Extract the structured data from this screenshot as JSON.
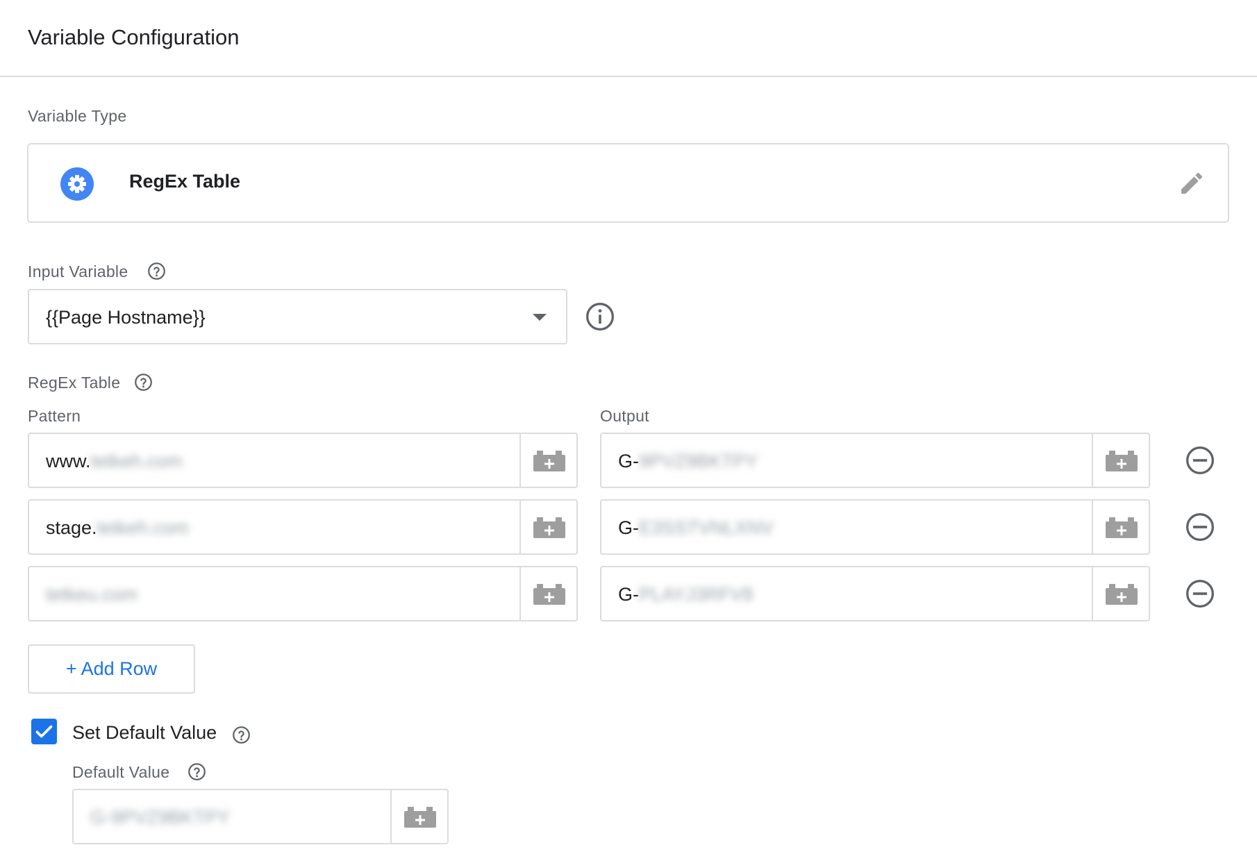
{
  "header": {
    "title": "Variable Configuration"
  },
  "variable_type": {
    "label": "Variable Type",
    "name": "RegEx Table",
    "icon": "gear-icon",
    "edit_icon": "pencil-icon"
  },
  "input_variable": {
    "label": "Input Variable",
    "value": "{{Page Hostname}}"
  },
  "regex_table": {
    "label": "RegEx Table",
    "pattern_header": "Pattern",
    "output_header": "Output",
    "rows": [
      {
        "pattern_prefix": "www.",
        "pattern_blurred": "tetkeh.com",
        "output_prefix": "G-",
        "output_blurred": "9PVZ9BKTPY"
      },
      {
        "pattern_prefix": "stage.",
        "pattern_blurred": "tetkeh.com",
        "output_prefix": "G-",
        "output_blurred": "E3SSTVNLXNV"
      },
      {
        "pattern_prefix": "",
        "pattern_blurred": "tetkeu.com",
        "output_prefix": "G-",
        "output_blurred": "PLAYJ3RFV8"
      }
    ],
    "add_row_label": "+ Add Row"
  },
  "default_value": {
    "checkbox_label": "Set Default Value",
    "checked": true,
    "label": "Default Value",
    "value_blurred": "G-9PVZ9BKTPY"
  },
  "colors": {
    "accent": "#1a73e8",
    "border": "#dadce0",
    "icon_gray": "#9e9e9e",
    "label_gray": "#5f6368"
  }
}
